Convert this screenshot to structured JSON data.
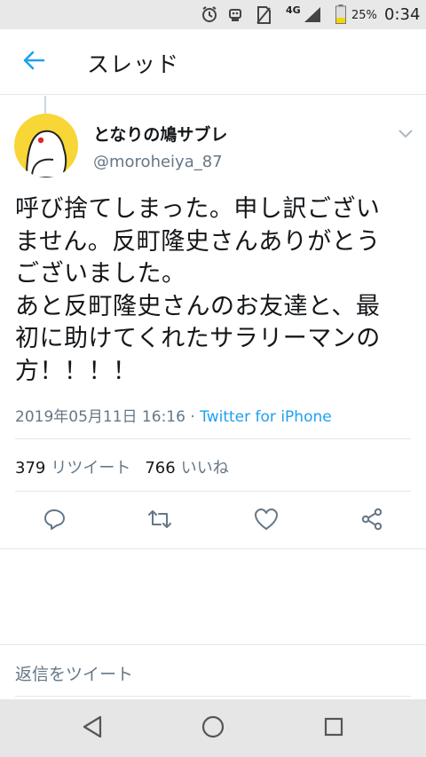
{
  "status_bar": {
    "network": "4G",
    "battery": "25%",
    "time": "0:34"
  },
  "header": {
    "back_icon": "arrow-left-icon",
    "title": "スレッド"
  },
  "tweet": {
    "display_name": "となりの鳩サブレ",
    "username": "@moroheiya_87",
    "text": "呼び捨てしまった。申し訳ござい\nません。反町隆史さんありがとう\nございました。\nあと反町隆史さんのお友達と、最\n初に助けてくれたサラリーマンの\n方！！！！",
    "timestamp": "2019年05月11日 16:16",
    "separator": " · ",
    "source": "Twitter for iPhone",
    "retweet_count": "379",
    "retweet_label": "リツイート",
    "like_count": "766",
    "like_label": "いいね"
  },
  "actions": [
    "reply-icon",
    "retweet-icon",
    "like-icon",
    "share-icon"
  ],
  "reply_placeholder": "返信をツイート",
  "colors": {
    "accent": "#1da1f2",
    "secondary_text": "#657786",
    "avatar_bg": "#f7d635"
  }
}
